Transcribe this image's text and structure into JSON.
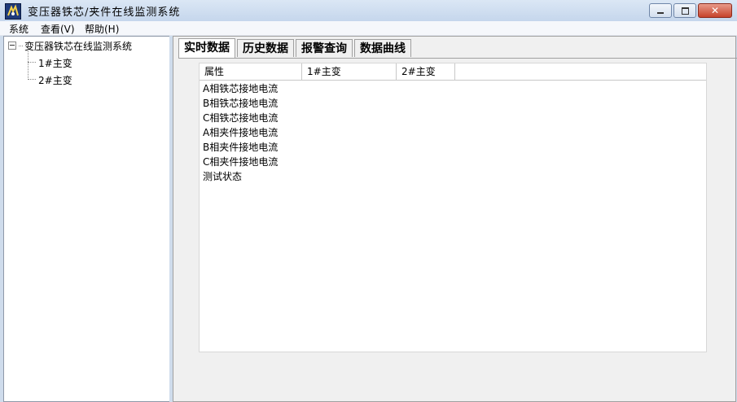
{
  "window": {
    "title": "变压器铁芯/夹件在线监测系统",
    "min_glyph": "",
    "max_glyph": "",
    "close_glyph": "✕"
  },
  "menu": [
    "系统",
    "查看(V)",
    "帮助(H)"
  ],
  "tree": {
    "root": "变压器铁芯在线监测系统",
    "children": [
      "1#主变",
      "2#主变"
    ]
  },
  "tabs": [
    "实时数据",
    "历史数据",
    "报警查询",
    "数据曲线"
  ],
  "table": {
    "columns": [
      "属性",
      "1#主变",
      "2#主变"
    ],
    "rows": [
      "A相铁芯接地电流",
      "B相铁芯接地电流",
      "C相铁芯接地电流",
      "A相夹件接地电流",
      "B相夹件接地电流",
      "C相夹件接地电流",
      "测试状态"
    ]
  },
  "icons": {
    "app": "app-logo-icon",
    "minimize": "minimize-icon",
    "maximize": "maximize-icon",
    "close": "close-icon",
    "expander": "tree-collapse-icon"
  },
  "colors": {
    "titlebar": "#cfdcec",
    "close_button": "#c6432c"
  }
}
